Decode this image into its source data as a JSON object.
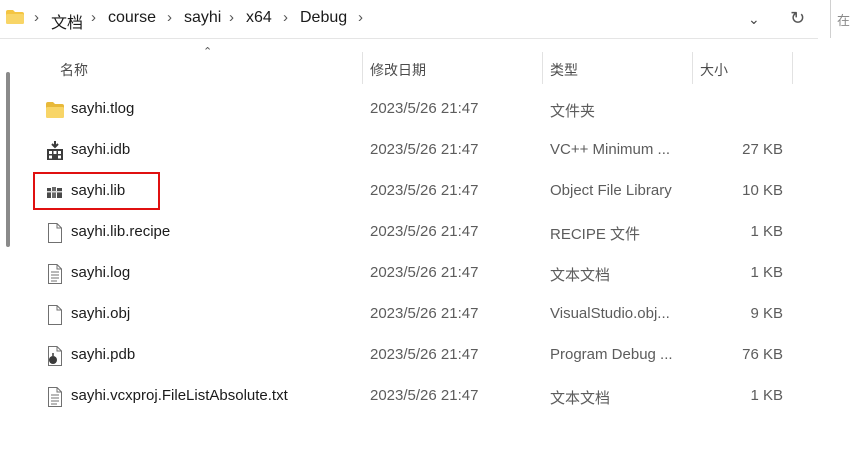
{
  "breadcrumb": [
    "文档",
    "course",
    "sayhi",
    "x64",
    "Debug"
  ],
  "search_partial": "在",
  "columns": {
    "name": "名称",
    "date": "修改日期",
    "type": "类型",
    "size": "大小"
  },
  "files": [
    {
      "name": "sayhi.tlog",
      "date": "2023/5/26 21:47",
      "type": "文件夹",
      "size": "",
      "icon": "folder-icon"
    },
    {
      "name": "sayhi.idb",
      "date": "2023/5/26 21:47",
      "type": "VC++ Minimum ...",
      "size": "27 KB",
      "icon": "idb-file-icon"
    },
    {
      "name": "sayhi.lib",
      "date": "2023/5/26 21:47",
      "type": "Object File Library",
      "size": "10 KB",
      "icon": "library-file-icon"
    },
    {
      "name": "sayhi.lib.recipe",
      "date": "2023/5/26 21:47",
      "type": "RECIPE 文件",
      "size": "1 KB",
      "icon": "blank-file-icon"
    },
    {
      "name": "sayhi.log",
      "date": "2023/5/26 21:47",
      "type": "文本文档",
      "size": "1 KB",
      "icon": "text-file-icon"
    },
    {
      "name": "sayhi.obj",
      "date": "2023/5/26 21:47",
      "type": "VisualStudio.obj...",
      "size": "9 KB",
      "icon": "blank-file-icon"
    },
    {
      "name": "sayhi.pdb",
      "date": "2023/5/26 21:47",
      "type": "Program Debug ...",
      "size": "76 KB",
      "icon": "pdb-file-icon"
    },
    {
      "name": "sayhi.vcxproj.FileListAbsolute.txt",
      "date": "2023/5/26 21:47",
      "type": "文本文档",
      "size": "1 KB",
      "icon": "text-file-icon"
    }
  ],
  "colors": {
    "highlight": "#e01010",
    "folder": "#f4c542"
  }
}
